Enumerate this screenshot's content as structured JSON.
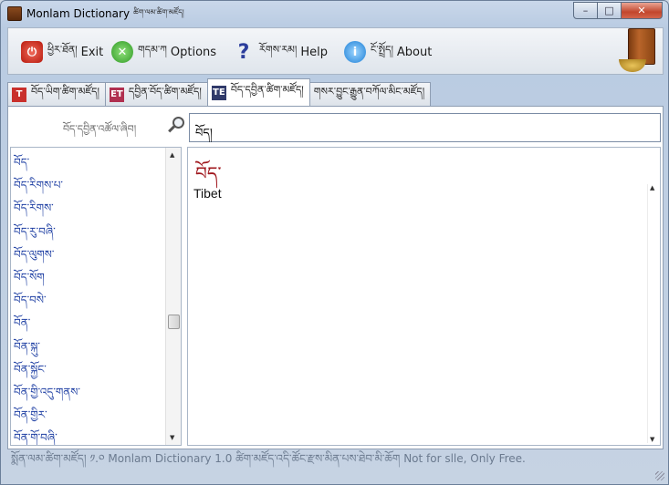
{
  "window": {
    "title": "Monlam Dictionary",
    "title_tibetan": "ཚིག་ལམ་ཚིག་མཛོད།",
    "controls": {
      "minimize": "–",
      "maximize": "□",
      "close": "✕"
    }
  },
  "toolbar": {
    "exit": {
      "tibetan": "ཕྱིར་ཐོན།",
      "label": "Exit"
    },
    "options": {
      "tibetan": "གདམ་ཀ",
      "label": "Options"
    },
    "help": {
      "tibetan": "རོགས་རམ།",
      "label": "Help"
    },
    "about": {
      "tibetan": "ངོ་སྤྲོད།",
      "label": "About"
    }
  },
  "tabs": [
    {
      "icon": "T",
      "label": "བོད་ཡིག་ཚིག་མཛོད།"
    },
    {
      "icon": "ET",
      "label": "དབྱིན་བོད་ཚིག་མཛོད།"
    },
    {
      "icon": "TE",
      "label": "བོད་དབྱིན་ཚིག་མཛོད།"
    },
    {
      "label": "གསར་བྱུང་རྒྱུན་བཀོལ་མིང་མཛོད།"
    }
  ],
  "search": {
    "label": "བོད་དབྱིན་འཚོལ་ཞིབ།",
    "value": "བོད།"
  },
  "word_list": [
    "བོད་",
    "བོད་རིགས་པ་",
    "བོད་རིགས་",
    "བོད་རུ་བཞི་",
    "བོད་ལུགས་",
    "བོད་སོག",
    "བོད་བསེ་",
    "བོན་",
    "བོན་སྐུ་",
    "བོན་སྐྱོང་",
    "བོན་གྱི་འདུ་གནས་",
    "བོན་གྱིར་",
    "བོན་གོ་བཞི་"
  ],
  "definition": {
    "headword": "བོད་",
    "text": "Tibet"
  },
  "status": {
    "text": "སྨོན་ལམ་ཚིག་མཛོད། ༡.༠ Monlam Dictionary 1.0   ཚིག་མཛོད་འདི་ཚོང་རྫས་མིན་པས་ཐེབ་མི་ཆོག Not for slle, Only Free."
  }
}
